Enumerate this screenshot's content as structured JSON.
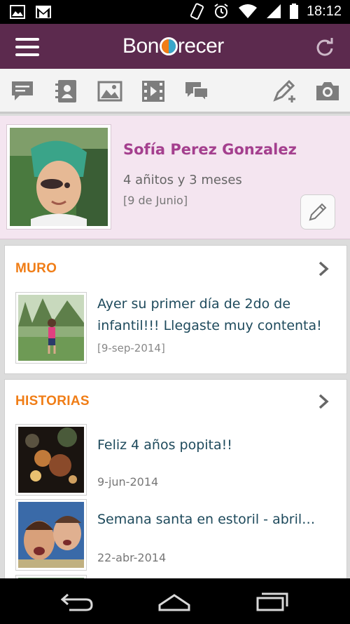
{
  "status_bar": {
    "time": "18:12",
    "icons_left": [
      "image-icon",
      "gmail-icon"
    ],
    "icons_right": [
      "vibrate-icon",
      "alarm-icon",
      "wifi-icon",
      "signal-icon",
      "battery-icon"
    ]
  },
  "app_bar": {
    "logo_prefix": "Bon",
    "logo_suffix": "recer",
    "menu_icon": "hamburger-icon",
    "refresh_icon": "refresh-icon",
    "color": "#5c2a4e"
  },
  "toolbar": {
    "icons": [
      "message-icon",
      "contacts-icon",
      "photo-icon",
      "video-icon",
      "chat-icon",
      "write-icon",
      "camera-icon"
    ]
  },
  "profile": {
    "name": "Sofía Perez Gonzalez",
    "age": "4 añitos y 3 meses",
    "birthday": "[9 de Junio]",
    "edit_icon": "pencil-icon",
    "name_color": "#a43f8e"
  },
  "muro": {
    "title": "MURO",
    "entry": {
      "text": "Ayer su primer día de 2do de infantil!!! Llegaste muy contenta!",
      "date": "[9-sep-2014]"
    }
  },
  "historias": {
    "title": "HISTORIAS",
    "items": [
      {
        "title": "Feliz 4 años popita!!",
        "date": "9-jun-2014"
      },
      {
        "title": "Semana santa en estoril - abril…",
        "date": "22-abr-2014"
      }
    ]
  },
  "accent_color": "#f07d16",
  "nav_bar": {
    "icons": [
      "back-icon",
      "home-icon",
      "recents-icon"
    ]
  }
}
